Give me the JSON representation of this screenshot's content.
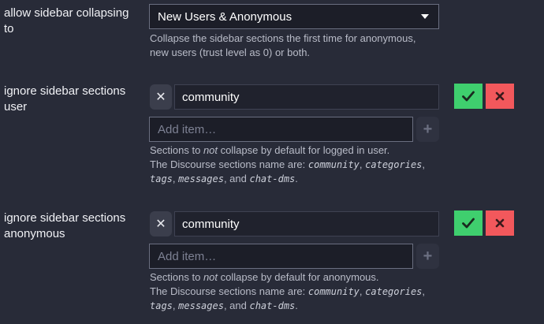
{
  "collapsing": {
    "label": "allow sidebar collapsing to",
    "selected": "New Users & Anonymous",
    "description": "Collapse the sidebar sections the first time for anonymous, new users (trust level as 0) or both."
  },
  "user_sections": {
    "label": "ignore sidebar sections user",
    "chip": "community",
    "add_placeholder": "Add item…",
    "desc_pre": "Sections to ",
    "desc_em": "not",
    "desc_post": " collapse by default for logged in user.",
    "names_intro": "The Discourse sections name are: ",
    "names": [
      "community",
      "categories",
      "tags",
      "messages",
      "chat-dms"
    ],
    "sep1": ", ",
    "sep2": ", ",
    "sep3": ", ",
    "sep4": ", and ",
    "end": "."
  },
  "anon_sections": {
    "label": "ignore sidebar sections anonymous",
    "chip": "community",
    "add_placeholder": "Add item…",
    "desc_pre": "Sections to ",
    "desc_em": "not",
    "desc_post": " collapse by default for anonymous.",
    "names_intro": "The Discourse sections name are: ",
    "names": [
      "community",
      "categories",
      "tags",
      "messages",
      "chat-dms"
    ],
    "sep1": ", ",
    "sep2": ", ",
    "sep3": ", ",
    "sep4": ", and ",
    "end": "."
  },
  "icons": {
    "remove": "x-icon",
    "add": "plus-icon",
    "ok": "check-icon",
    "cancel": "close-icon",
    "dropdown": "caret-down-icon"
  },
  "colors": {
    "background": "#282b38",
    "ok": "#3fcf6e",
    "cancel": "#f2585c"
  }
}
